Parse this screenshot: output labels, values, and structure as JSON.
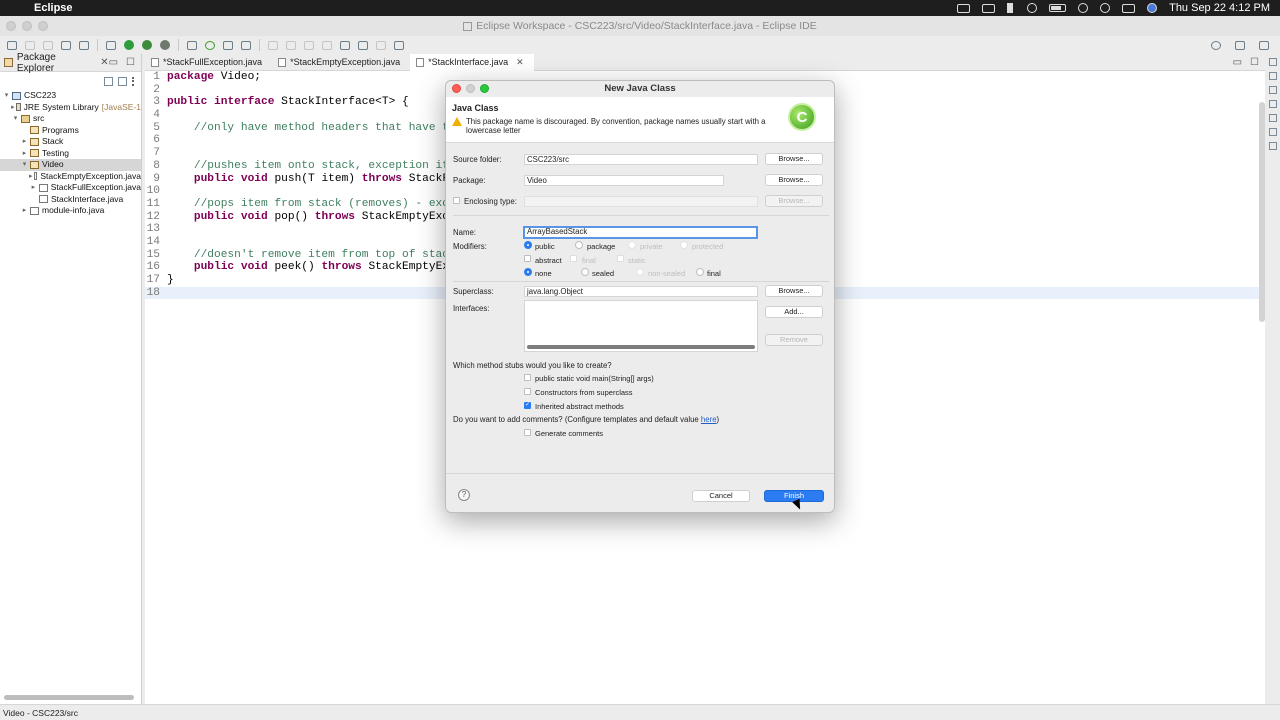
{
  "menubar": {
    "app_name": "Eclipse",
    "clock": "Thu Sep 22  4:12 PM"
  },
  "window": {
    "title": "Eclipse Workspace - CSC223/src/Video/StackInterface.java - Eclipse IDE"
  },
  "explorer": {
    "tab_label": "Package Explorer",
    "tree": [
      {
        "label": "CSC223",
        "depth": 0,
        "arrow": "▾",
        "icon": "project-icon",
        "kind": "proj"
      },
      {
        "label": "JRE System Library",
        "extra": "[JavaSE-1",
        "depth": 1,
        "arrow": "▸",
        "icon": "library-icon",
        "kind": "lib"
      },
      {
        "label": "src",
        "depth": 1,
        "arrow": "▾",
        "icon": "source-folder-icon",
        "kind": "src"
      },
      {
        "label": "Programs",
        "depth": 2,
        "arrow": "",
        "icon": "package-icon",
        "kind": "pkg"
      },
      {
        "label": "Stack",
        "depth": 2,
        "arrow": "▸",
        "icon": "package-icon",
        "kind": "pkg"
      },
      {
        "label": "Testing",
        "depth": 2,
        "arrow": "▸",
        "icon": "package-icon",
        "kind": "pkg"
      },
      {
        "label": "Video",
        "depth": 2,
        "arrow": "▾",
        "icon": "package-icon",
        "kind": "pkg",
        "selected": true
      },
      {
        "label": "StackEmptyException.java",
        "depth": 3,
        "arrow": "▸",
        "icon": "java-file-icon",
        "kind": "file"
      },
      {
        "label": "StackFullException.java",
        "depth": 3,
        "arrow": "▸",
        "icon": "java-file-icon",
        "kind": "file"
      },
      {
        "label": "StackInterface.java",
        "depth": 3,
        "arrow": "",
        "icon": "java-file-icon",
        "kind": "file"
      },
      {
        "label": "module-info.java",
        "depth": 2,
        "arrow": "▸",
        "icon": "java-file-icon",
        "kind": "file"
      }
    ]
  },
  "editor": {
    "tabs": [
      {
        "label": "*StackFullException.java",
        "active": false
      },
      {
        "label": "*StackEmptyException.java",
        "active": false
      },
      {
        "label": "*StackInterface.java",
        "active": true
      }
    ],
    "lines": [
      {
        "n": "1",
        "parts": [
          [
            "kw",
            "package"
          ],
          [
            "txt",
            " Video;"
          ]
        ]
      },
      {
        "n": "2",
        "parts": []
      },
      {
        "n": "3",
        "parts": [
          [
            "kw",
            "public"
          ],
          [
            "txt",
            " "
          ],
          [
            "kw",
            "interface"
          ],
          [
            "txt",
            " StackInterface<T> {"
          ]
        ]
      },
      {
        "n": "4",
        "parts": []
      },
      {
        "n": "5",
        "parts": [
          [
            "txt",
            "    "
          ],
          [
            "cm",
            "//only have method headers that have t"
          ]
        ]
      },
      {
        "n": "6",
        "parts": []
      },
      {
        "n": "7",
        "parts": []
      },
      {
        "n": "8",
        "parts": [
          [
            "txt",
            "    "
          ],
          [
            "cm",
            "//pushes item onto stack, exception if"
          ]
        ]
      },
      {
        "n": "9",
        "parts": [
          [
            "txt",
            "    "
          ],
          [
            "kw",
            "public"
          ],
          [
            "txt",
            " "
          ],
          [
            "kw",
            "void"
          ],
          [
            "txt",
            " push(T item) "
          ],
          [
            "kw",
            "throws"
          ],
          [
            "txt",
            " StackF"
          ]
        ]
      },
      {
        "n": "10",
        "parts": []
      },
      {
        "n": "11",
        "parts": [
          [
            "txt",
            "    "
          ],
          [
            "cm",
            "//pops item from stack (removes) - exc"
          ]
        ]
      },
      {
        "n": "12",
        "parts": [
          [
            "txt",
            "    "
          ],
          [
            "kw",
            "public"
          ],
          [
            "txt",
            " "
          ],
          [
            "kw",
            "void"
          ],
          [
            "txt",
            " pop() "
          ],
          [
            "kw",
            "throws"
          ],
          [
            "txt",
            " StackEmptyExc"
          ]
        ]
      },
      {
        "n": "13",
        "parts": []
      },
      {
        "n": "14",
        "parts": []
      },
      {
        "n": "15",
        "parts": [
          [
            "txt",
            "    "
          ],
          [
            "cm",
            "//doesn't remove item from top of stac"
          ]
        ]
      },
      {
        "n": "16",
        "parts": [
          [
            "txt",
            "    "
          ],
          [
            "kw",
            "public"
          ],
          [
            "txt",
            " "
          ],
          [
            "kw",
            "void"
          ],
          [
            "txt",
            " peek() "
          ],
          [
            "kw",
            "throws"
          ],
          [
            "txt",
            " StackEmptyEx"
          ]
        ]
      },
      {
        "n": "17",
        "parts": [
          [
            "txt",
            "}"
          ]
        ]
      },
      {
        "n": "18",
        "parts": [],
        "highlight": true
      }
    ]
  },
  "status": {
    "text": "Video - CSC223/src"
  },
  "dialog": {
    "title": "New Java Class",
    "header_title": "Java Class",
    "warning": "This package name is discouraged. By convention, package names usually start with a lowercase letter",
    "logo_letter": "C",
    "source_folder_label": "Source folder:",
    "source_folder_value": "CSC223/src",
    "package_label": "Package:",
    "package_value": "Video",
    "enclosing_label": "Enclosing type:",
    "enclosing_value": "",
    "browse": "Browse...",
    "name_label": "Name:",
    "name_value": "ArrayBasedStack",
    "modifiers_label": "Modifiers:",
    "mod_public": "public",
    "mod_package": "package",
    "mod_private": "private",
    "mod_protected": "protected",
    "mod_abstract": "abstract",
    "mod_final": "final",
    "mod_static": "static",
    "mod_none": "none",
    "mod_sealed": "sealed",
    "mod_non_sealed": "non-sealed",
    "mod_final2": "final",
    "superclass_label": "Superclass:",
    "superclass_value": "java.lang.Object",
    "interfaces_label": "Interfaces:",
    "add": "Add...",
    "remove": "Remove",
    "stubs_question": "Which method stubs would you like to create?",
    "stub_main": "public static void main(String[] args)",
    "stub_constructors": "Constructors from superclass",
    "stub_inherited": "Inherited abstract methods",
    "comments_question_pre": "Do you want to add comments? (Configure templates and default value ",
    "comments_link": "here",
    "comments_question_post": ")",
    "generate_comments": "Generate comments",
    "help": "?",
    "cancel": "Cancel",
    "finish": "Finish"
  }
}
